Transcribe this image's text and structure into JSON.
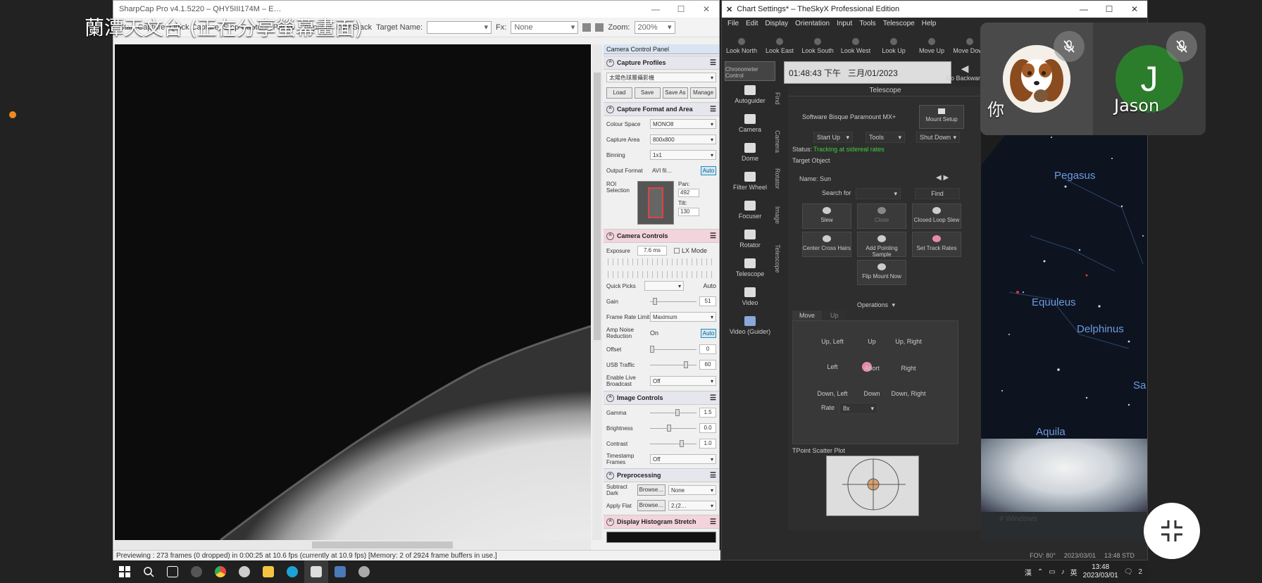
{
  "share_banner": "蘭潭天文台 (正在分享螢幕畫面)",
  "sharpcap": {
    "title": "SharpCap Pro v4.1.5220 – QHY5III174M – E…",
    "toolbar": {
      "start_capture": "Start Capture",
      "quick_capture": "Quick Capture",
      "stop_capture": "Stop Capture",
      "pause": "Pause",
      "snapshot": "Snapshot",
      "live_stack": "Live Stack",
      "target_name_label": "Target Name:",
      "fx_label": "Fx:",
      "fx_value": "None",
      "zoom_label": "Zoom:",
      "zoom_value": "200%"
    },
    "status_bar": "Previewing : 273 frames (0 dropped) in 0:00:25 at 10.6 fps  (currently at 10.9 fps) [Memory: 2 of 2924 frame buffers in use.]",
    "control_panel": {
      "title": "Camera Control Panel",
      "capture_profiles": {
        "header": "Capture Profiles",
        "profile": "太陽色球層攝影機",
        "buttons": [
          "Load",
          "Save",
          "Save As",
          "Manage"
        ]
      },
      "capture_format": {
        "header": "Capture Format and Area",
        "colour_space_label": "Colour Space",
        "colour_space": "MONO8",
        "capture_area_label": "Capture Area",
        "capture_area": "800x800",
        "binning_label": "Binning",
        "binning": "1x1",
        "output_format_label": "Output Format",
        "output_format": "AVI fil…",
        "auto": "Auto",
        "roi_label": "ROI Selection",
        "pan_label": "Pan:",
        "pan": "492",
        "tilt_label": "Tilt:",
        "tilt": "130"
      },
      "camera_controls": {
        "header": "Camera Controls",
        "exposure_label": "Exposure",
        "exposure": "7.6 ms",
        "lx_mode": "LX Mode",
        "quick_picks_label": "Quick Picks",
        "auto": "Auto",
        "gain_label": "Gain",
        "gain": "51",
        "frame_rate_label": "Frame Rate Limit",
        "frame_rate": "Maximum",
        "amp_noise_label": "Amp Noise Reduction",
        "amp_noise": "On",
        "offset_label": "Offset",
        "offset": "0",
        "usb_traffic_label": "USB Traffic",
        "usb_traffic": "60",
        "live_broadcast_label": "Enable Live Broadcast",
        "live_broadcast": "Off"
      },
      "image_controls": {
        "header": "Image Controls",
        "gamma_label": "Gamma",
        "gamma": "1.5",
        "brightness_label": "Brightness",
        "brightness": "0.0",
        "contrast_label": "Contrast",
        "contrast": "1.0",
        "timestamp_label": "Timestamp Frames",
        "timestamp": "Off"
      },
      "preprocessing": {
        "header": "Preprocessing",
        "subtract_dark_label": "Subtract Dark",
        "browse": "Browse…",
        "subtract_dark": "None",
        "apply_flat_label": "Apply Flat",
        "apply_flat": "2.(2…"
      },
      "histogram": {
        "header": "Display Histogram Stretch"
      }
    }
  },
  "theskyx": {
    "title": "Chart Settings* – TheSkyX Professional Edition",
    "menu": [
      "File",
      "Edit",
      "Display",
      "Orientation",
      "Input",
      "Tools",
      "Telescope",
      "Help"
    ],
    "toolbar": [
      "Look North",
      "Look East",
      "Look South",
      "Look West",
      "Look Up",
      "Move Up",
      "Move Down"
    ],
    "chronometer": "Chronometer Control",
    "time": "01:48:43 下午",
    "date": "三月/01/2023",
    "go_back": "Go Backward",
    "side_tools": [
      "Autoguider",
      "Camera",
      "Dome",
      "Filter Wheel",
      "Focuser",
      "Rotator",
      "Telescope",
      "Video",
      "Video (Guider)"
    ],
    "vertical_tabs": [
      "Find",
      "Camera",
      "Rotator",
      "Image",
      "Telescope"
    ],
    "telescope": {
      "header": "Telescope",
      "mount": "Software Bisque Paramount MX+",
      "mount_setup": "Mount Setup",
      "start_up": "Start Up",
      "tools": "Tools",
      "shut_down": "Shut Down",
      "status_label": "Status:",
      "status": "Tracking at sidereal rates",
      "target_object": "Target Object",
      "name_label": "Name:",
      "name": "Sun",
      "search_for": "Search for",
      "find": "Find",
      "buttons": [
        "Slew",
        "Close",
        "Closed Loop Slew",
        "Center Cross Hairs",
        "Add Pointing Sample",
        "Set Track Rates",
        "Flip Mount Now"
      ],
      "options": "Operations",
      "move_tabs": [
        "Move",
        "Up"
      ],
      "directions": [
        "Up, Left",
        "Up",
        "Up, Right",
        "Left",
        "Abort",
        "Right",
        "Down, Left",
        "Down",
        "Down, Right"
      ],
      "rate_label": "Rate",
      "rate": "8x",
      "tpoint": "TPoint Scatter Plot"
    },
    "sky": {
      "constellations": [
        "Pegasus",
        "Equuleus",
        "Delphinus",
        "Aquila",
        "Sa"
      ],
      "ground_text": "# Windows"
    },
    "status_bar": [
      "FOV: 80°",
      "2023/03/01",
      "13:48 STD"
    ]
  },
  "participants": [
    {
      "name": "你",
      "muted": true
    },
    {
      "name": "Jason",
      "initial": "J",
      "muted": true
    }
  ],
  "taskbar": {
    "ime": "漢",
    "lang": "英",
    "time": "13:48",
    "date": "2023/03/01",
    "notifications": "2"
  }
}
